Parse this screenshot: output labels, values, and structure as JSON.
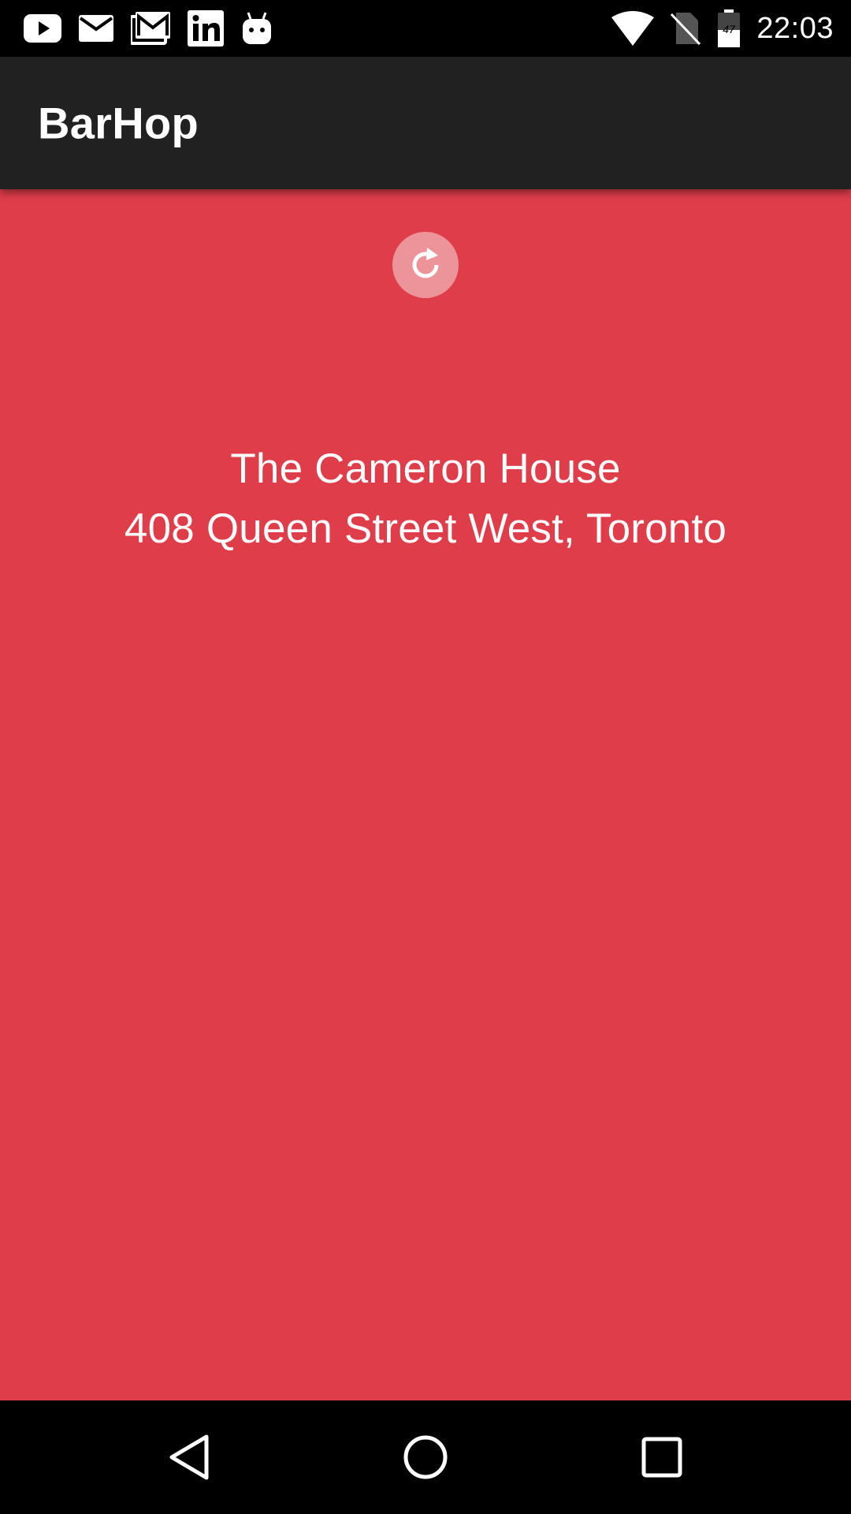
{
  "status_bar": {
    "time": "22:03",
    "battery_level": "47",
    "notification_icons": [
      "youtube-icon",
      "mail-icon",
      "gmail-icon",
      "linkedin-icon",
      "android-icon"
    ],
    "system_icons": [
      "wifi-icon",
      "no-sim-icon",
      "battery-icon"
    ]
  },
  "app_bar": {
    "title": "BarHop"
  },
  "content": {
    "background_color": "#df3d4a",
    "refresh_icon": "refresh-icon",
    "bar_name": "The Cameron House",
    "bar_address": "408 Queen Street West, Toronto"
  },
  "nav_bar": {
    "buttons": [
      "back-icon",
      "home-icon",
      "recents-icon"
    ]
  }
}
